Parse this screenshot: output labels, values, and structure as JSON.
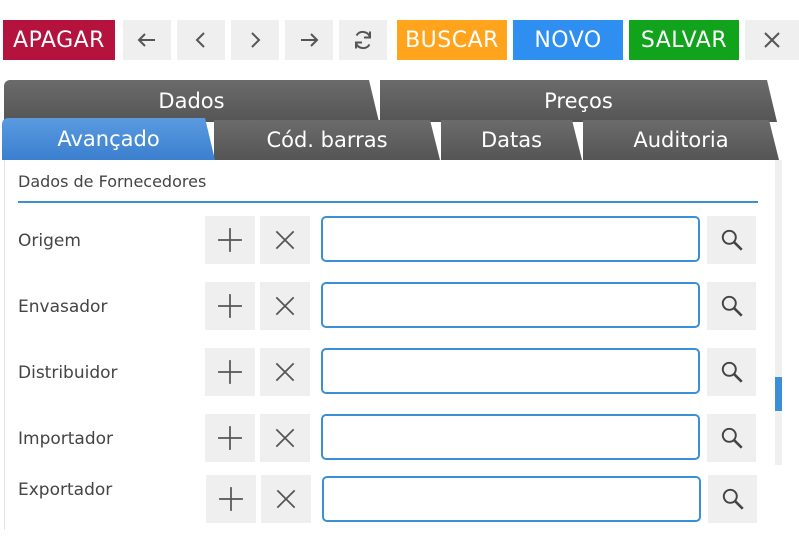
{
  "toolbar": {
    "delete_label": "APAGAR",
    "search_label": "BUSCAR",
    "new_label": "NOVO",
    "save_label": "SALVAR",
    "colors": {
      "delete": "#b5123e",
      "search": "#ffa41c",
      "new": "#2f8ff0",
      "save": "#11a31c"
    },
    "icons": [
      "arrow-left-icon",
      "chevron-left-icon",
      "chevron-right-icon",
      "arrow-right-icon",
      "refresh-icon",
      "close-icon"
    ]
  },
  "tabs": {
    "top": [
      "Dados",
      "Preços"
    ],
    "bottom": [
      "Avançado",
      "Cód. barras",
      "Datas",
      "Auditoria"
    ],
    "active": "Avançado"
  },
  "section": {
    "title": "Dados de Fornecedores"
  },
  "fields": [
    {
      "label": "Origem",
      "value": ""
    },
    {
      "label": "Envasador",
      "value": ""
    },
    {
      "label": "Distribuidor",
      "value": ""
    },
    {
      "label": "Importador",
      "value": ""
    },
    {
      "label": "Exportador",
      "value": ""
    }
  ]
}
